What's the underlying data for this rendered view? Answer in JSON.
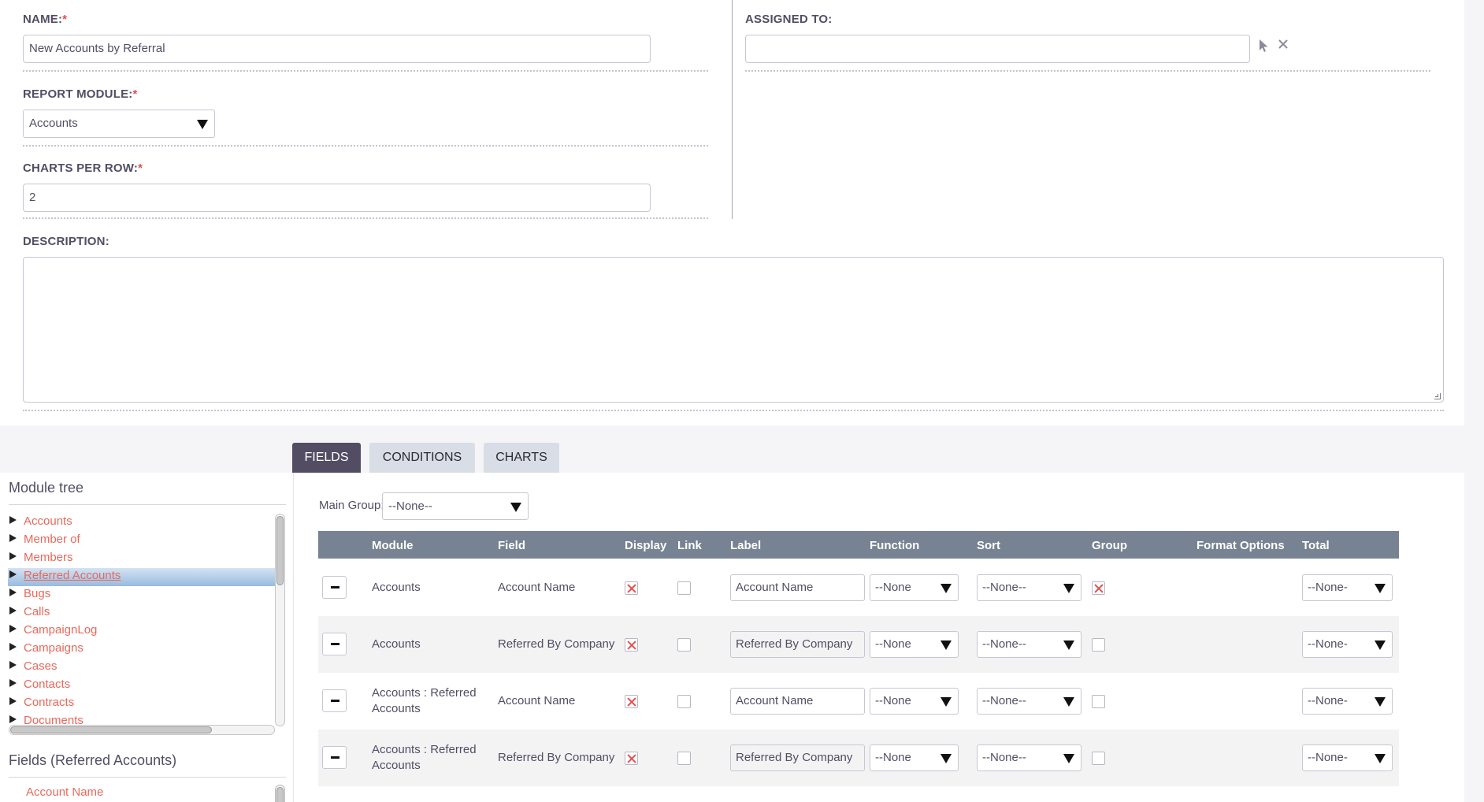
{
  "form": {
    "name_label": "NAME:",
    "name_value": "New Accounts by Referral",
    "report_module_label": "REPORT MODULE:",
    "report_module_value": "Accounts",
    "charts_per_row_label": "CHARTS PER ROW:",
    "charts_per_row_value": "2",
    "assigned_to_label": "ASSIGNED TO:",
    "assigned_to_value": "",
    "description_label": "DESCRIPTION:",
    "description_value": "",
    "required_marker": "*"
  },
  "tabs": [
    {
      "label": "FIELDS",
      "active": true
    },
    {
      "label": "CONDITIONS",
      "active": false
    },
    {
      "label": "CHARTS",
      "active": false
    }
  ],
  "module_tree": {
    "title": "Module tree",
    "items": [
      {
        "label": "Accounts"
      },
      {
        "label": "Member of"
      },
      {
        "label": "Members"
      },
      {
        "label": "Referred Accounts",
        "selected": true
      },
      {
        "label": "Bugs"
      },
      {
        "label": "Calls"
      },
      {
        "label": "CampaignLog"
      },
      {
        "label": "Campaigns"
      },
      {
        "label": "Cases"
      },
      {
        "label": "Contacts"
      },
      {
        "label": "Contracts"
      },
      {
        "label": "Documents"
      }
    ]
  },
  "fields_panel": {
    "title": "Fields (Referred Accounts)",
    "items": [
      "Account Name"
    ]
  },
  "main_group": {
    "label": "Main Group:",
    "value": "--None--"
  },
  "table": {
    "headers": {
      "module": "Module",
      "field": "Field",
      "display": "Display",
      "link": "Link",
      "label": "Label",
      "function": "Function",
      "sort": "Sort",
      "group": "Group",
      "format": "Format Options",
      "total": "Total"
    },
    "rows": [
      {
        "module_line1": "Accounts",
        "module_line2": "",
        "field": "Account Name",
        "display": true,
        "link": false,
        "label": "Account Name",
        "function": "--None",
        "sort": "--None--",
        "group": true,
        "total": "--None-"
      },
      {
        "module_line1": "Accounts",
        "module_line2": "",
        "field": "Referred By Company",
        "display": true,
        "link": false,
        "label": "Referred By Company",
        "function": "--None",
        "sort": "--None--",
        "group": false,
        "total": "--None-"
      },
      {
        "module_line1": "Accounts : Referred",
        "module_line2": "Accounts",
        "field": "Account Name",
        "display": true,
        "link": false,
        "label": "Account Name",
        "function": "--None",
        "sort": "--None--",
        "group": false,
        "total": "--None-"
      },
      {
        "module_line1": "Accounts : Referred",
        "module_line2": "Accounts",
        "field": "Referred By Company",
        "display": true,
        "link": false,
        "label": "Referred By Company",
        "function": "--None",
        "sort": "--None--",
        "group": false,
        "total": "--None-"
      }
    ]
  },
  "colors": {
    "accent": "#534d64",
    "link": "#e8695b",
    "required": "#e34f4f",
    "table_header": "#778392",
    "tab_inactive": "#d8dde6"
  }
}
